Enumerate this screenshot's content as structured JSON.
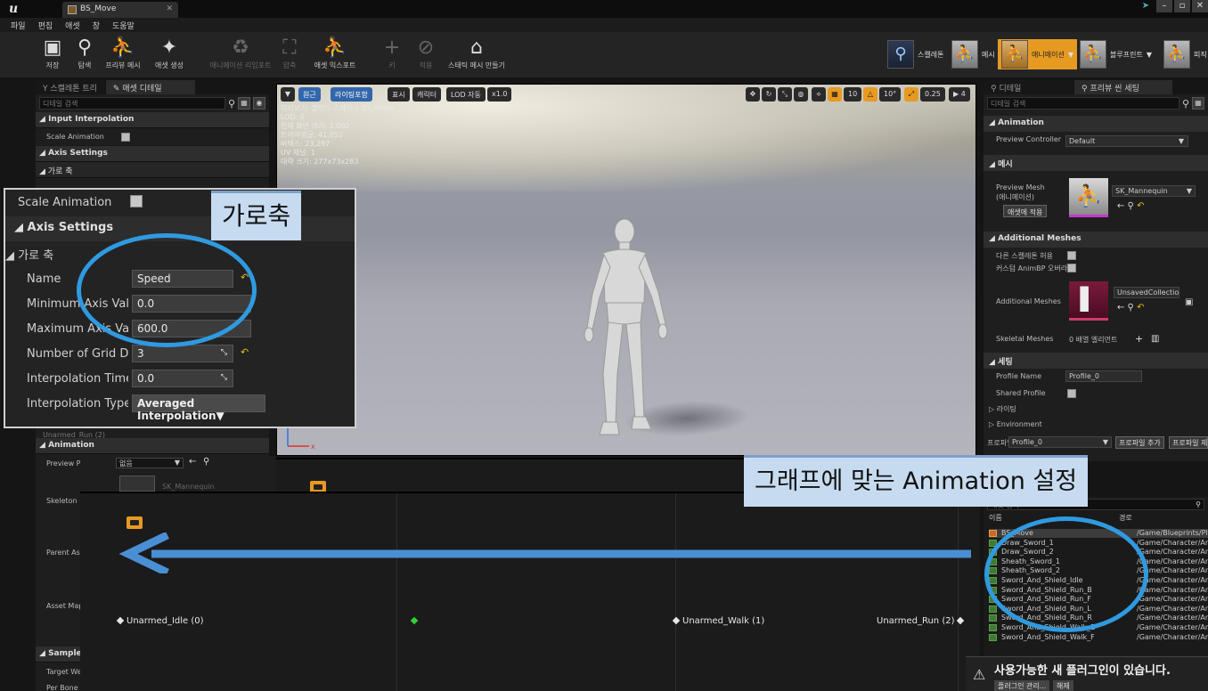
{
  "titlebar": {
    "tab_title": "BS_Move"
  },
  "menu": [
    "파일",
    "편집",
    "애셋",
    "창",
    "도움말"
  ],
  "toolbar": {
    "save": "저장",
    "browse": "탐색",
    "preview_mesh": "프리뷰 메시",
    "create_asset": "애셋 생성",
    "reimport_anim": "애니메이션 리임포트",
    "compress": "압축",
    "export_asset": "애셋 익스포트",
    "key": "키",
    "apply": "적용",
    "make_static_mesh": "스태틱 메시 만들기"
  },
  "modes": {
    "skeleton": "스켈레톤",
    "mesh": "메시",
    "animation": "애니메이션",
    "blueprint": "블루프린트",
    "physics": "피직"
  },
  "left_panel": {
    "tab_skeleton_tree": "스켈레톤 트리",
    "tab_asset_details": "애셋 디테일",
    "search_placeholder": "디테일 검색",
    "cat_input_interp": "Input Interpolation",
    "row_scale_anim": "Scale Animation",
    "cat_axis_settings": "Axis Settings",
    "cat_horizontal": "가로 축",
    "cat_animation": "Animation",
    "row_preview_pose": "Preview Pose Asset",
    "preview_pose_value": "없음",
    "row_skeleton": "Skeleton",
    "skeleton_value": "SK_Mannequin",
    "row_parent": "Parent Ass",
    "row_asset_map": "Asset Map",
    "cat_sample": "Sample Ir",
    "row_target": "Target We",
    "row_per_bone": "Per Bone E",
    "partial_row": "Unarmed_Run (2)"
  },
  "zoom": {
    "scale_animation": "Scale Animation",
    "axis_settings": "Axis Settings",
    "horizontal_axis": "가로 축",
    "name_label": "Name",
    "name_value": "Speed",
    "min_label": "Minimum Axis Valu",
    "min_value": "0.0",
    "max_label": "Maximum Axis Val",
    "max_value": "600.0",
    "grid_label": "Number of Grid Divi",
    "grid_value": "3",
    "interp_time_label": "Interpolation Time",
    "interp_time_value": "0.0",
    "interp_type_label": "Interpolation Type",
    "interp_type_value": "Averaged Interpolation"
  },
  "callouts": {
    "axis": "가로축",
    "animation": "그래프에 맞는 Animation 설정"
  },
  "viewport": {
    "btn_perspective": "원근",
    "btn_lit": "라이팅포함",
    "btn_show": "표시",
    "btn_character": "캐릭터",
    "btn_lod": "LOD 자동",
    "btn_speed": "x1.0",
    "grid_snap": "10",
    "rot_snap": "10°",
    "scale_snap": "0.25",
    "cam_speed": "4",
    "info": [
      "미리보기: 블렌드 스페이스 BS_Move",
      "LOD: 0",
      "현재 화면 크기: 1.002",
      "트라이앵글: 41,052",
      "버텍스: 23,297",
      "UV 채널: 1",
      "대략 크기: 277x73x283"
    ]
  },
  "graph": {
    "idle": "Unarmed_Idle (0)",
    "walk": "Unarmed_Walk (1)",
    "run": "Unarmed_Run (2)"
  },
  "right_panel": {
    "tab_details": "디테일",
    "tab_preview_scene": "프리뷰 씬 세팅",
    "search_placeholder": "디테일 검색",
    "cat_animation": "Animation",
    "preview_controller_label": "Preview Controller",
    "preview_controller_value": "Default",
    "cat_mesh": "메시",
    "preview_mesh_label": "Preview Mesh",
    "preview_mesh_sub": "(애니메이션)",
    "apply_to_asset": "애셋에 적용",
    "preview_mesh_value": "SK_Mannequin",
    "cat_additional_meshes": "Additional Meshes",
    "allow_other_skel": "다른 스켈레톤 허용",
    "custom_animbp": "커스텀 AnimBP 오버라",
    "additional_meshes_label": "Additional Meshes",
    "additional_meshes_value": "UnsavedCollection",
    "skeletal_meshes_label": "Skeletal Meshes",
    "skeletal_meshes_value": "0 배열 엘리먼트",
    "cat_settings": "세팅",
    "profile_name_label": "Profile Name",
    "profile_name_value": "Profile_0",
    "shared_profile_label": "Shared Profile",
    "lighting": "라이팅",
    "environment": "Environment",
    "profile_label": "프로파일",
    "profile_value": "Profile_0",
    "add_profile": "프로파일 추가",
    "remove_profile": "프로파일 제"
  },
  "asset_browser": {
    "search_placeholder": "애셋 검색",
    "col_name": "이름",
    "col_path": "경로",
    "rows": [
      {
        "name": "BS_Move",
        "path": "/Game/Blueprints/Pla"
      },
      {
        "name": "Draw_Sword_1",
        "path": "/Game/Character/An"
      },
      {
        "name": "Draw_Sword_2",
        "path": "/Game/Character/An"
      },
      {
        "name": "Sheath_Sword_1",
        "path": "/Game/Character/An"
      },
      {
        "name": "Sheath_Sword_2",
        "path": "/Game/Character/An"
      },
      {
        "name": "Sword_And_Shield_Idle",
        "path": "/Game/Character/An"
      },
      {
        "name": "Sword_And_Shield_Run_B",
        "path": "/Game/Character/An"
      },
      {
        "name": "Sword_And_Shield_Run_F",
        "path": "/Game/Character/An"
      },
      {
        "name": "Sword_And_Shield_Run_L",
        "path": "/Game/Character/An"
      },
      {
        "name": "Sword_And_Shield_Run_R",
        "path": "/Game/Character/An"
      },
      {
        "name": "Sword_And_Shield_Walk_B",
        "path": "/Game/Character/An"
      },
      {
        "name": "Sword_And_Shield_Walk_F",
        "path": "/Game/Character/An"
      }
    ]
  },
  "notification": {
    "message": "사용가능한 새 플러그인이 있습니다.",
    "manage": "플러그인 관리...",
    "dismiss": "해제"
  },
  "colors": {
    "accent_orange": "#e79a22",
    "highlight_blue": "#2f9ae0",
    "callout_bg": "#c7dbf0"
  }
}
